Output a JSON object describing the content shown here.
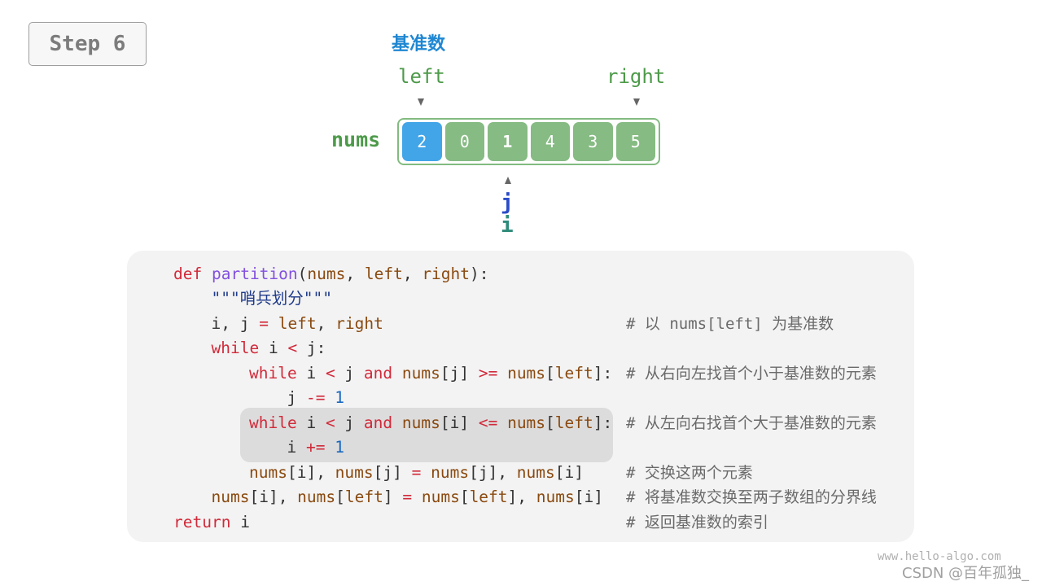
{
  "step": {
    "label": "Step 6"
  },
  "pivot_label": "基准数",
  "pointers": {
    "left": "left",
    "right": "right",
    "j": "j",
    "i": "i"
  },
  "array": {
    "name": "nums",
    "values": [
      "2",
      "0",
      "1",
      "4",
      "3",
      "5"
    ],
    "pivot_index": 0,
    "i_index": 2,
    "j_index": 2,
    "colors": {
      "pivot": "#42a5e8",
      "cell": "#86bb83",
      "border": "#82bb80"
    }
  },
  "code": {
    "lines": [
      {
        "indent": 0,
        "tokens": [
          [
            "kw",
            "def"
          ],
          [
            "plain",
            " "
          ],
          [
            "fn",
            "partition"
          ],
          [
            "plain",
            "("
          ],
          [
            "id",
            "nums"
          ],
          [
            "plain",
            ", "
          ],
          [
            "id",
            "left"
          ],
          [
            "plain",
            ", "
          ],
          [
            "id",
            "right"
          ],
          [
            "plain",
            "):"
          ]
        ],
        "comment": ""
      },
      {
        "indent": 1,
        "tokens": [
          [
            "str",
            "\"\"\"哨兵划分\"\"\""
          ]
        ],
        "comment": ""
      },
      {
        "indent": 1,
        "tokens": [
          [
            "plain",
            "i, j "
          ],
          [
            "op",
            "="
          ],
          [
            "plain",
            " "
          ],
          [
            "id",
            "left"
          ],
          [
            "plain",
            ", "
          ],
          [
            "id",
            "right"
          ]
        ],
        "comment": "# 以 nums[left] 为基准数"
      },
      {
        "indent": 1,
        "tokens": [
          [
            "kw",
            "while"
          ],
          [
            "plain",
            " i "
          ],
          [
            "op",
            "<"
          ],
          [
            "plain",
            " j:"
          ]
        ],
        "comment": ""
      },
      {
        "indent": 2,
        "tokens": [
          [
            "kw",
            "while"
          ],
          [
            "plain",
            " i "
          ],
          [
            "op",
            "<"
          ],
          [
            "plain",
            " j "
          ],
          [
            "kw",
            "and"
          ],
          [
            "plain",
            " "
          ],
          [
            "id",
            "nums"
          ],
          [
            "plain",
            "[j] "
          ],
          [
            "op",
            ">="
          ],
          [
            "plain",
            " "
          ],
          [
            "id",
            "nums"
          ],
          [
            "plain",
            "["
          ],
          [
            "id",
            "left"
          ],
          [
            "plain",
            "]:"
          ]
        ],
        "comment": "# 从右向左找首个小于基准数的元素"
      },
      {
        "indent": 3,
        "tokens": [
          [
            "plain",
            "j "
          ],
          [
            "op",
            "-="
          ],
          [
            "plain",
            " "
          ],
          [
            "num",
            "1"
          ]
        ],
        "comment": ""
      },
      {
        "indent": 2,
        "tokens": [
          [
            "kw",
            "while"
          ],
          [
            "plain",
            " i "
          ],
          [
            "op",
            "<"
          ],
          [
            "plain",
            " j "
          ],
          [
            "kw",
            "and"
          ],
          [
            "plain",
            " "
          ],
          [
            "id",
            "nums"
          ],
          [
            "plain",
            "[i] "
          ],
          [
            "op",
            "<="
          ],
          [
            "plain",
            " "
          ],
          [
            "id",
            "nums"
          ],
          [
            "plain",
            "["
          ],
          [
            "id",
            "left"
          ],
          [
            "plain",
            "]:"
          ]
        ],
        "comment": "# 从左向右找首个大于基准数的元素"
      },
      {
        "indent": 3,
        "tokens": [
          [
            "plain",
            "i "
          ],
          [
            "op",
            "+="
          ],
          [
            "plain",
            " "
          ],
          [
            "num",
            "1"
          ]
        ],
        "comment": ""
      },
      {
        "indent": 2,
        "tokens": [
          [
            "id",
            "nums"
          ],
          [
            "plain",
            "[i], "
          ],
          [
            "id",
            "nums"
          ],
          [
            "plain",
            "[j] "
          ],
          [
            "op",
            "="
          ],
          [
            "plain",
            " "
          ],
          [
            "id",
            "nums"
          ],
          [
            "plain",
            "[j], "
          ],
          [
            "id",
            "nums"
          ],
          [
            "plain",
            "[i]"
          ]
        ],
        "comment": "# 交换这两个元素"
      },
      {
        "indent": 1,
        "tokens": [
          [
            "id",
            "nums"
          ],
          [
            "plain",
            "[i], "
          ],
          [
            "id",
            "nums"
          ],
          [
            "plain",
            "["
          ],
          [
            "id",
            "left"
          ],
          [
            "plain",
            "] "
          ],
          [
            "op",
            "="
          ],
          [
            "plain",
            " "
          ],
          [
            "id",
            "nums"
          ],
          [
            "plain",
            "["
          ],
          [
            "id",
            "left"
          ],
          [
            "plain",
            "], "
          ],
          [
            "id",
            "nums"
          ],
          [
            "plain",
            "[i]"
          ]
        ],
        "comment": "# 将基准数交换至两子数组的分界线"
      },
      {
        "indent": 0,
        "tokens": [
          [
            "kw",
            "return"
          ],
          [
            "plain",
            " i"
          ]
        ],
        "comment": "# 返回基准数的索引"
      }
    ],
    "highlighted_lines": [
      6,
      7
    ]
  },
  "watermark": {
    "site": "www.hello-algo.com",
    "author": "CSDN @百年孤独_"
  }
}
